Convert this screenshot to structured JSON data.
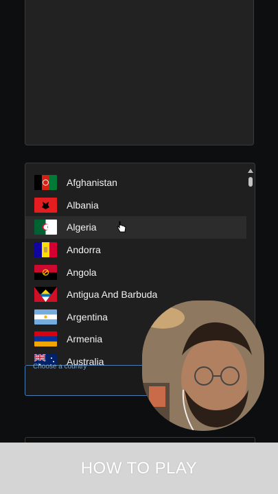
{
  "dropdown": {
    "countries": [
      {
        "name": "Afghanistan",
        "flag": "afghanistan-flag-icon"
      },
      {
        "name": "Albania",
        "flag": "albania-flag-icon"
      },
      {
        "name": "Algeria",
        "flag": "algeria-flag-icon"
      },
      {
        "name": "Andorra",
        "flag": "andorra-flag-icon"
      },
      {
        "name": "Angola",
        "flag": "angola-flag-icon"
      },
      {
        "name": "Antigua And Barbuda",
        "flag": "antigua-and-barbuda-flag-icon"
      },
      {
        "name": "Argentina",
        "flag": "argentina-flag-icon"
      },
      {
        "name": "Armenia",
        "flag": "armenia-flag-icon"
      },
      {
        "name": "Australia",
        "flag": "australia-flag-icon"
      }
    ],
    "hovered_item": "Algeria"
  },
  "country_field": {
    "label": "Choose a country",
    "value": ""
  },
  "how_to_play": {
    "label": "HOW TO PLAY"
  },
  "colors": {
    "background": "#0d0e10",
    "panel": "#222222",
    "dropdown": "#1f1f1f",
    "hover": "#2c2c2c",
    "field_border": "#4a7fb5",
    "footer_bar": "#d5d5d5"
  }
}
